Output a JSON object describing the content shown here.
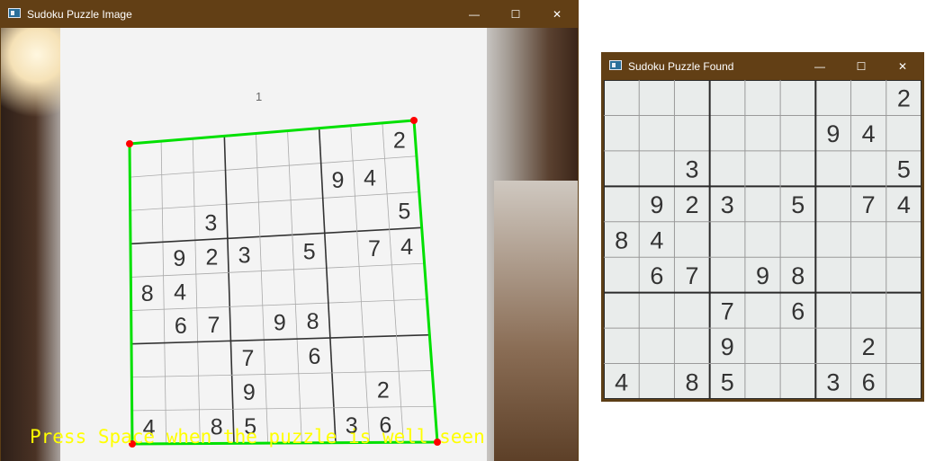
{
  "window1": {
    "title": "Sudoku Puzzle Image",
    "controls": {
      "minimize": "—",
      "maximize": "☐",
      "close": "✕"
    },
    "page_number": "1",
    "instruction": "Press Space when the puzzle is well seen",
    "colors": {
      "outline": "#00e000",
      "corners": "#ff0000",
      "instruction": "#ffff00"
    }
  },
  "window2": {
    "title": "Sudoku Puzzle Found",
    "controls": {
      "minimize": "—",
      "maximize": "☐",
      "close": "✕"
    }
  },
  "grid": [
    [
      "",
      "",
      "",
      "",
      "",
      "",
      "",
      "",
      "2"
    ],
    [
      "",
      "",
      "",
      "",
      "",
      "",
      "9",
      "4",
      ""
    ],
    [
      "",
      "",
      "3",
      "",
      "",
      "",
      "",
      "",
      "5"
    ],
    [
      "",
      "9",
      "2",
      "3",
      "",
      "5",
      "",
      "7",
      "4"
    ],
    [
      "8",
      "4",
      "",
      "",
      "",
      "",
      "",
      "",
      ""
    ],
    [
      "",
      "6",
      "7",
      "",
      "9",
      "8",
      "",
      "",
      ""
    ],
    [
      "",
      "",
      "",
      "7",
      "",
      "6",
      "",
      "",
      ""
    ],
    [
      "",
      "",
      "",
      "9",
      "",
      "",
      "",
      "2",
      ""
    ],
    [
      "4",
      "",
      "8",
      "5",
      "",
      "",
      "3",
      "6",
      ""
    ]
  ]
}
